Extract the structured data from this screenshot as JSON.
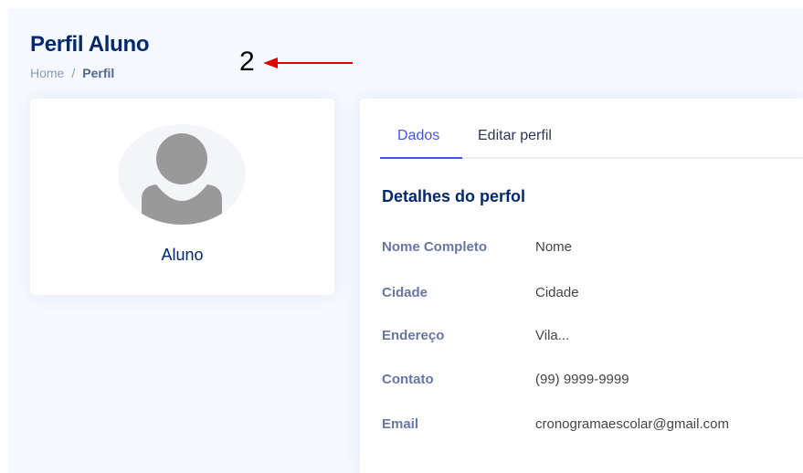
{
  "header": {
    "title": "Perfil Aluno",
    "breadcrumb": {
      "home": "Home",
      "separator": "/",
      "current": "Perfil"
    }
  },
  "annotation": {
    "label": "2",
    "arrow_color": "#e00000"
  },
  "profile": {
    "avatar_icon": "user-silhouette-icon",
    "name": "Aluno"
  },
  "tabs": [
    {
      "label": "Dados",
      "active": true
    },
    {
      "label": "Editar perfil",
      "active": false
    }
  ],
  "details": {
    "section_title": "Detalhes do perfol",
    "rows": [
      {
        "label": "Nome Completo",
        "value": "Nome"
      },
      {
        "label": "Cidade",
        "value": "Cidade"
      },
      {
        "label": "Endereço",
        "value": "Vila..."
      },
      {
        "label": "Contato",
        "value": "(99) 9999-9999"
      },
      {
        "label": "Email",
        "value": "cronogramaescolar@gmail.com"
      }
    ]
  },
  "colors": {
    "brand_dark": "#012970",
    "accent": "#4154f1",
    "background": "#f6f9ff"
  }
}
